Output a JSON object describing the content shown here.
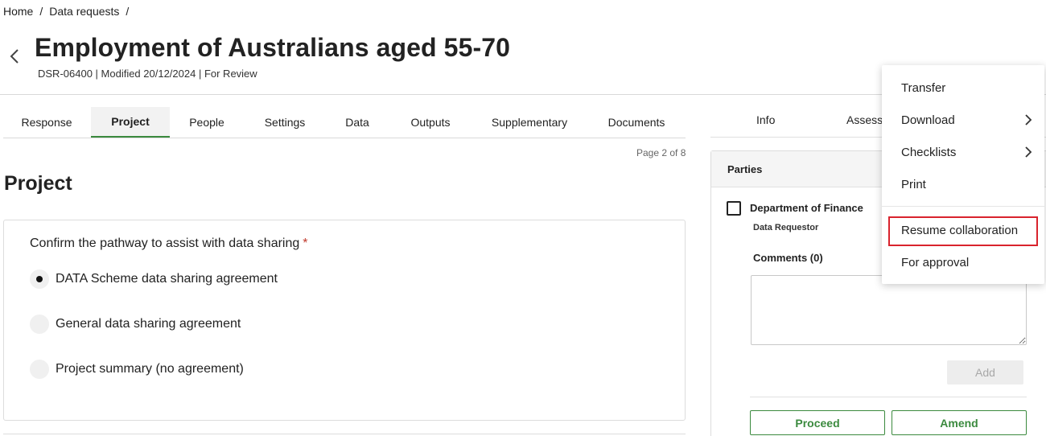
{
  "breadcrumb": {
    "home": "Home",
    "data_requests": "Data requests",
    "sep": "/"
  },
  "header": {
    "title": "Employment of Australians aged 55-70",
    "meta": "DSR-06400 | Modified 20/12/2024 | For Review"
  },
  "tabs": [
    "Response",
    "Project",
    "People",
    "Settings",
    "Data",
    "Outputs",
    "Supplementary",
    "Documents"
  ],
  "active_tab": "Project",
  "page_indicator": "Page 2 of 8",
  "section": {
    "title": "Project"
  },
  "question": {
    "label": "Confirm the pathway to assist with data sharing",
    "required_mark": "*",
    "options": [
      "DATA Scheme data sharing agreement",
      "General data sharing agreement",
      "Project summary (no agreement)"
    ],
    "selected_index": 0
  },
  "right_tabs": [
    "Info",
    "Assessm"
  ],
  "parties": {
    "title": "Parties",
    "party_name": "Department of Finance",
    "party_role": "Data Requestor",
    "comments_label": "Comments (0)",
    "add_label": "Add",
    "proceed_label": "Proceed",
    "amend_label": "Amend"
  },
  "menu": {
    "items": [
      "Transfer",
      "Download",
      "Checklists",
      "Print",
      "Resume collaboration",
      "For approval"
    ],
    "highlighted": "Resume collaboration"
  },
  "colors": {
    "accent": "#3b8a3e",
    "highlight": "#d9232d",
    "required": "#c0392b"
  }
}
